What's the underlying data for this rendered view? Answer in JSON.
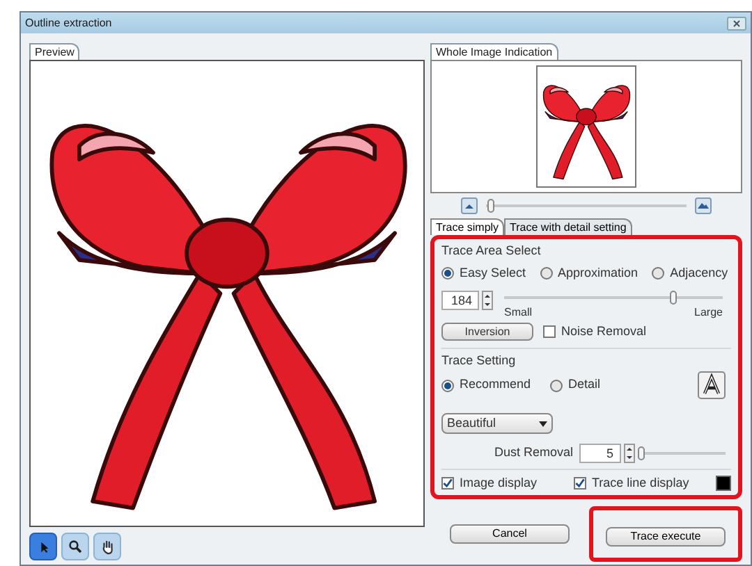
{
  "window": {
    "title": "Outline extraction"
  },
  "preview_tab": "Preview",
  "overview_tab": "Whole Image Indication",
  "zoom": {
    "level": 0.02
  },
  "trace_tabs": [
    {
      "label": "Trace simply",
      "selected": true
    },
    {
      "label": "Trace with detail setting",
      "selected": false
    }
  ],
  "area_select": {
    "title": "Trace Area Select",
    "options": [
      {
        "label": "Easy Select",
        "selected": true
      },
      {
        "label": "Approximation",
        "selected": false
      },
      {
        "label": "Adjacency",
        "selected": false
      }
    ],
    "value": "184",
    "slider": {
      "level": 0.77,
      "min_label": "Small",
      "max_label": "Large"
    },
    "inversion": "Inversion",
    "noise_removal": {
      "label": "Noise Removal",
      "checked": false
    }
  },
  "trace_setting": {
    "title": "Trace Setting",
    "options": [
      {
        "label": "Recommend",
        "selected": true
      },
      {
        "label": "Detail",
        "selected": false
      }
    ],
    "style": "Beautiful",
    "dust_label": "Dust Removal",
    "dust_value": "5",
    "dust_slider": {
      "level": 0.04
    }
  },
  "displays": [
    {
      "label": "Image display",
      "checked": true
    },
    {
      "label": "Trace line display",
      "checked": true
    }
  ],
  "tools": [
    {
      "kind": "pointer",
      "selected": true
    },
    {
      "kind": "zoom",
      "selected": false
    },
    {
      "kind": "hand",
      "selected": false
    }
  ],
  "buttons": [
    "Cancel",
    "Trace execute"
  ]
}
